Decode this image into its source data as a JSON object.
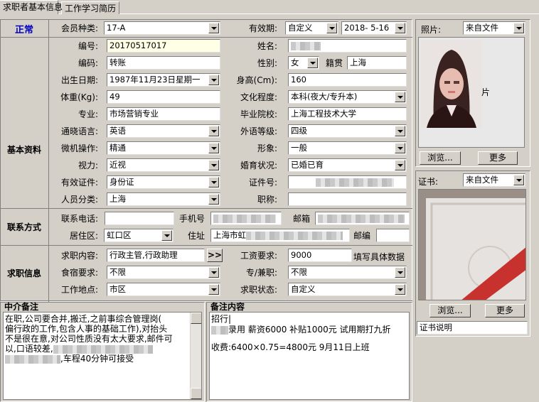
{
  "tabs": [
    "求职者基本信息",
    "工作学习简历"
  ],
  "status": "正常",
  "sections": {
    "basic": "基本资料",
    "contact": "联系方式",
    "job": "求职信息",
    "agency_note": "中介备注",
    "note": "备注内容"
  },
  "labels": {
    "member_type": "会员种类:",
    "validity": "有效期:",
    "number": "编号:",
    "name": "姓名:",
    "code": "编码:",
    "gender": "性别:",
    "native": "籍贯",
    "birth": "出生日期:",
    "height": "身高(Cm):",
    "weight": "体重(Kg):",
    "education": "文化程度:",
    "major": "专业:",
    "school": "毕业院校:",
    "language": "通晓语言:",
    "lang_level": "外语等级:",
    "computer": "微机操作:",
    "appearance": "形象:",
    "vision": "视力:",
    "marital": "婚育状况:",
    "id_type": "有效证件:",
    "id_no": "证件号:",
    "category": "人员分类:",
    "title": "职称:",
    "phone": "联系电话:",
    "mobile": "手机号",
    "email": "邮箱",
    "district": "居住区:",
    "address": "住址",
    "zip": "邮编",
    "job_wanted": "求职内容:",
    "salary": "工资要求:",
    "board": "食宿要求:",
    "fulltime": "专/兼职:",
    "location": "工作地点:",
    "job_status": "求职状态:",
    "photo": "照片:",
    "cert": "证书:"
  },
  "values": {
    "member_type": "17-A",
    "validity_mode": "自定义",
    "validity_date": "2018- 5-16",
    "number": "20170517017",
    "name": "",
    "code": "转账",
    "gender": "女",
    "native": "上海",
    "birth": "1987年11月23日星期一",
    "height": "160",
    "weight": "49",
    "education": "本科(夜大/专升本)",
    "major": "市场营销专业",
    "school": "上海工程技术大学",
    "language": "英语",
    "lang_level": "四级",
    "computer": "精通",
    "appearance": "一般",
    "vision": "近视",
    "marital": "已婚已育",
    "id_type": "身份证",
    "category": "上海",
    "title": "",
    "phone": "",
    "district": "虹口区",
    "address": "上海市虹",
    "job_wanted": "行政主管,行政助理",
    "salary": "9000",
    "salary_hint": "填写具体数据",
    "board": "不限",
    "fulltime": "不限",
    "location": "市区",
    "job_status": "自定义",
    "photo_source": "来自文件",
    "photo_char": "片",
    "cert_source": "来自文件",
    "cert_desc": "证书说明"
  },
  "buttons": {
    "browse": "浏览...",
    "more": "更多",
    "arrow": ">>"
  },
  "agency_note_lines": [
    "在职,公司要合并,搬迁,之前事综合管理岗(",
    "偏行政的工作,包含人事的基础工作),对抬头",
    "不是很在意,对公司性质没有太大要求,邮件可",
    "以,口语较差,",
    ",车程40分钟可接受"
  ],
  "note_lines": [
    "招行|",
    "录用 薪资6000 补贴1000元 试用期打九折",
    "",
    "收费:6400×0.75=4800元 9月11日上班"
  ]
}
